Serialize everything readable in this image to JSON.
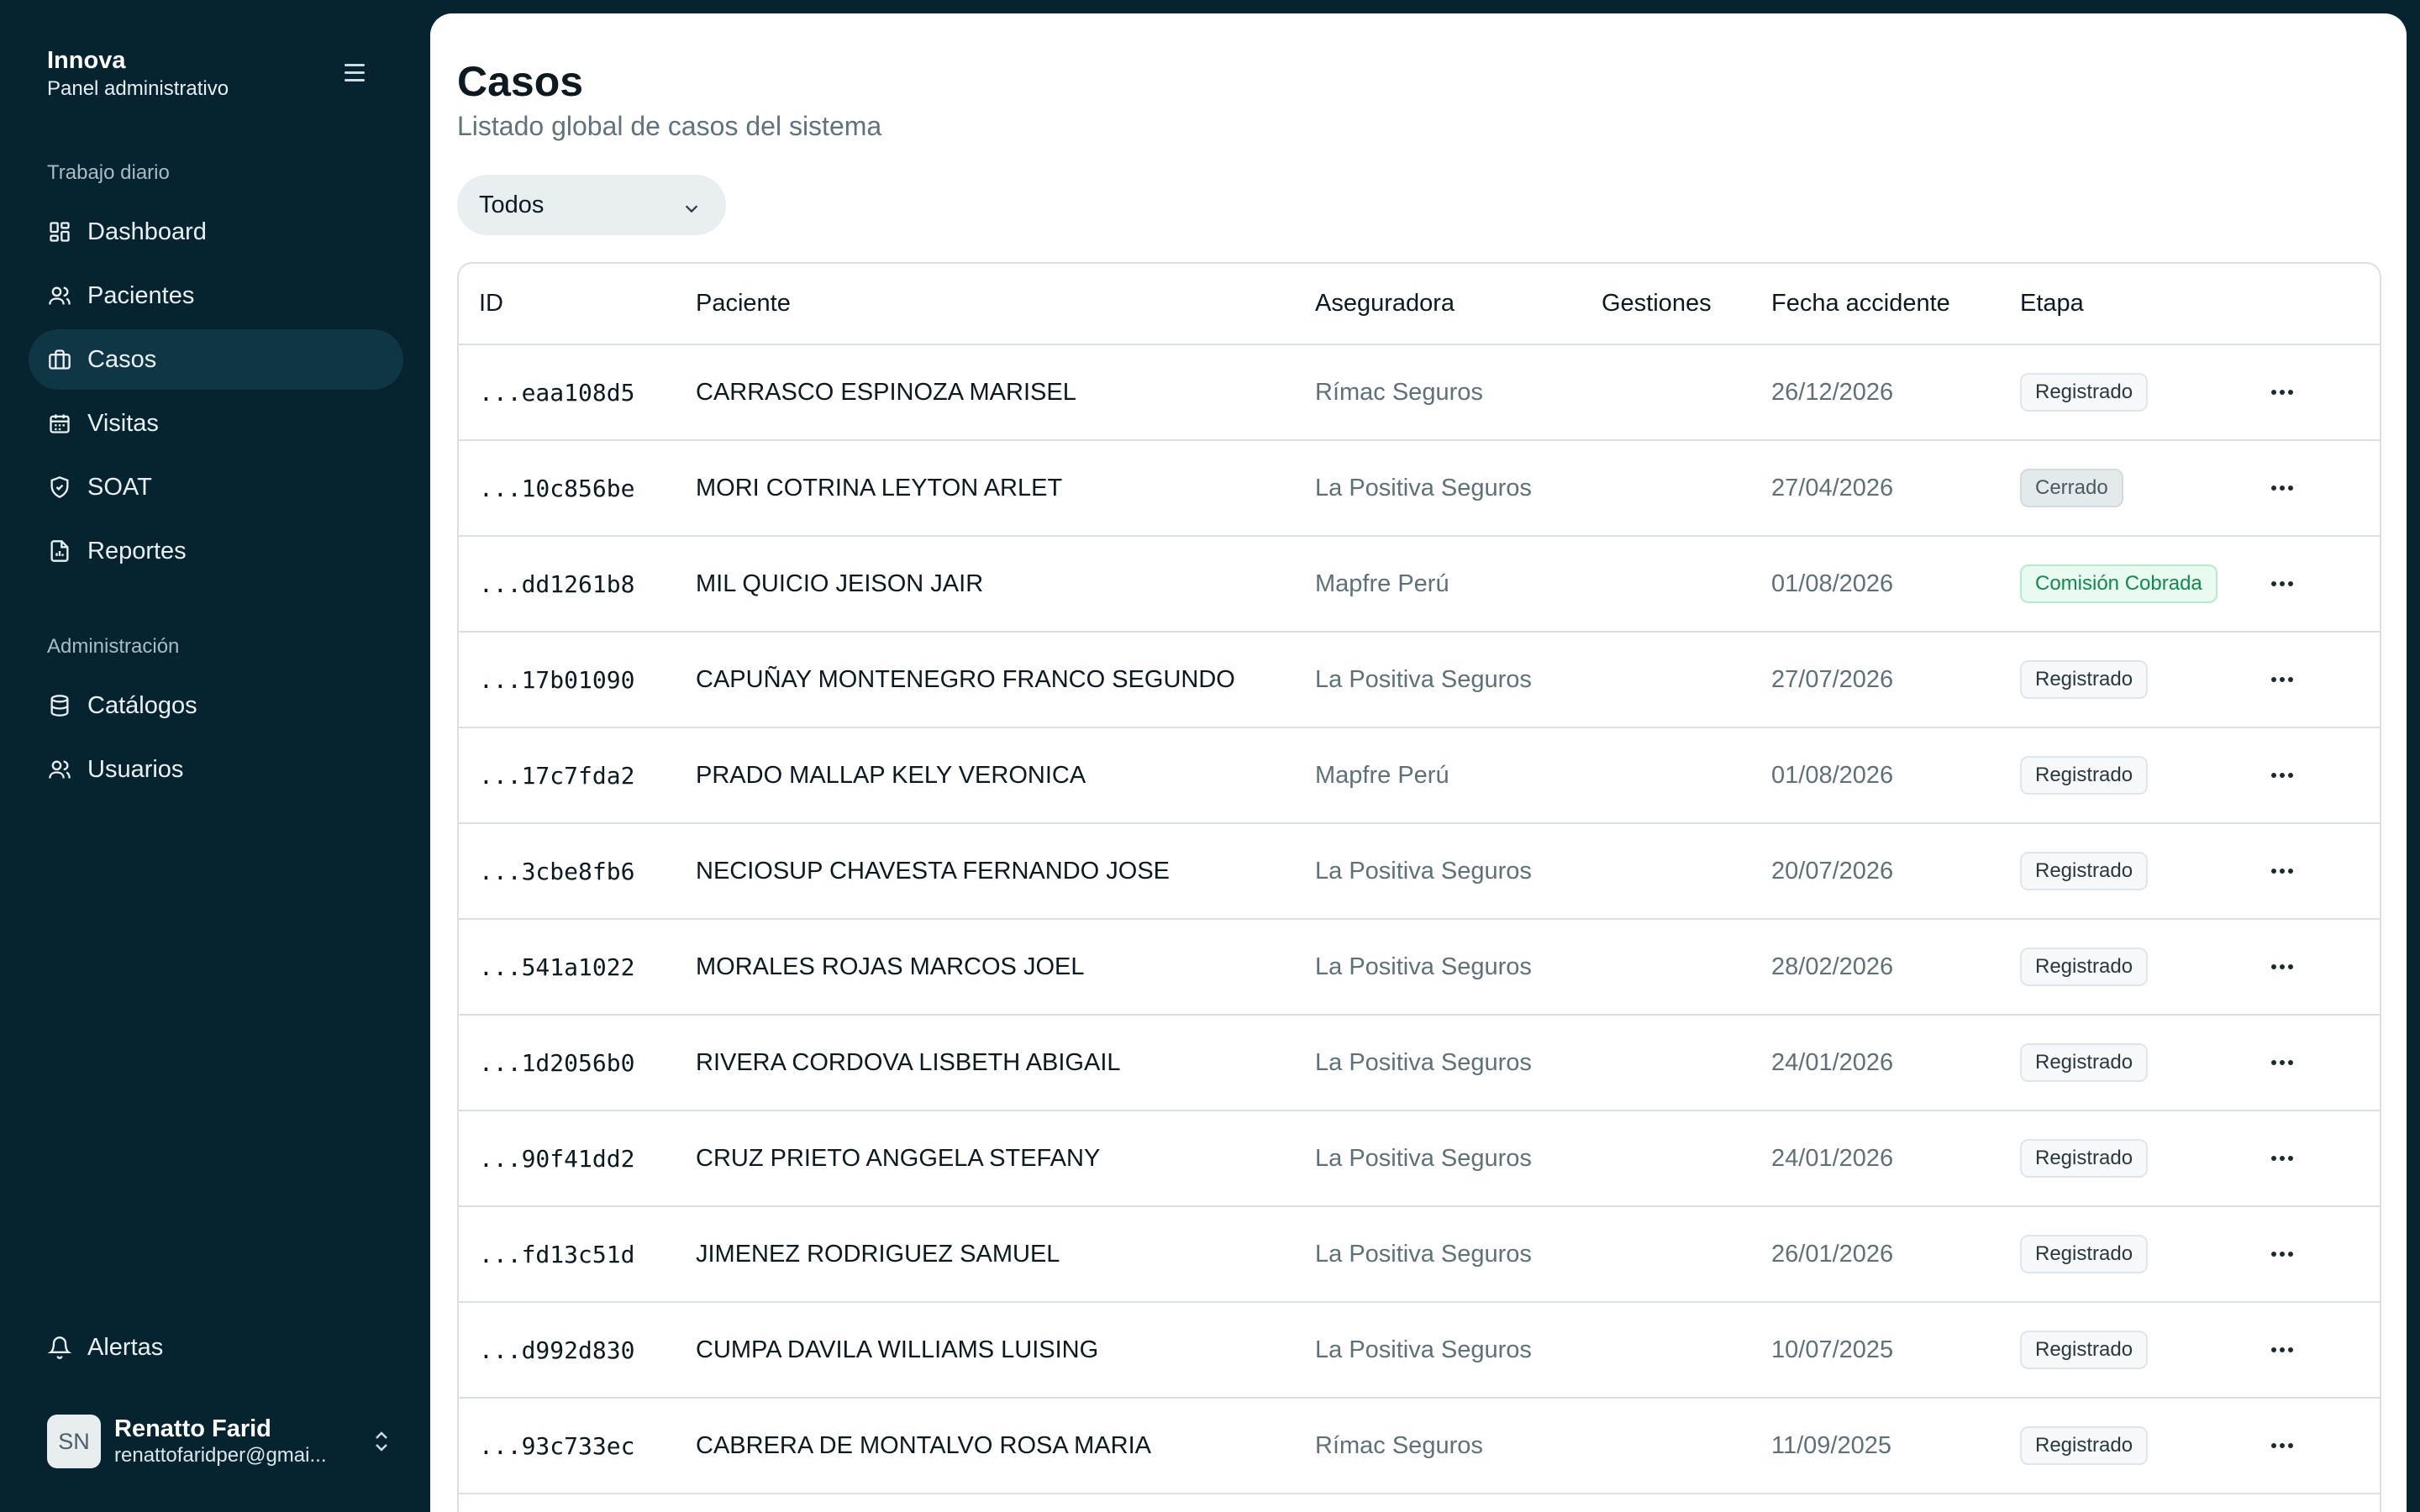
{
  "app": {
    "title": "Innova",
    "subtitle": "Panel administrativo"
  },
  "sidebar": {
    "section_daily": "Trabajo diario",
    "section_admin": "Administración",
    "items": [
      {
        "label": "Dashboard",
        "icon": "dashboard-icon"
      },
      {
        "label": "Pacientes",
        "icon": "users-icon"
      },
      {
        "label": "Casos",
        "icon": "briefcase-icon",
        "active": true
      },
      {
        "label": "Visitas",
        "icon": "calendar-icon"
      },
      {
        "label": "SOAT",
        "icon": "shield-icon"
      },
      {
        "label": "Reportes",
        "icon": "report-icon"
      }
    ],
    "admin_items": [
      {
        "label": "Catálogos",
        "icon": "database-icon"
      },
      {
        "label": "Usuarios",
        "icon": "users-icon"
      }
    ],
    "alerts_label": "Alertas",
    "user": {
      "initials": "SN",
      "name": "Renatto Farid",
      "email": "renattofaridper@gmai..."
    }
  },
  "main": {
    "title": "Casos",
    "subtitle": "Listado global de casos del sistema",
    "filter": {
      "selected": "Todos"
    },
    "table": {
      "headers": [
        "ID",
        "Paciente",
        "Aseguradora",
        "Gestiones",
        "Fecha accidente",
        "Etapa"
      ],
      "rows": [
        {
          "id": "...eaa108d5",
          "paciente": "CARRASCO ESPINOZA MARISEL",
          "aseguradora": "Rímac Seguros",
          "gestiones": "",
          "fecha": "26/12/2026",
          "etapa": "Registrado"
        },
        {
          "id": "...10c856be",
          "paciente": "MORI COTRINA LEYTON ARLET",
          "aseguradora": "La Positiva Seguros",
          "gestiones": "",
          "fecha": "27/04/2026",
          "etapa": "Cerrado"
        },
        {
          "id": "...dd1261b8",
          "paciente": "MIL QUICIO JEISON JAIR",
          "aseguradora": "Mapfre Perú",
          "gestiones": "",
          "fecha": "01/08/2026",
          "etapa": "Comisión Cobrada"
        },
        {
          "id": "...17b01090",
          "paciente": "CAPUÑAY MONTENEGRO FRANCO SEGUNDO",
          "aseguradora": "La Positiva Seguros",
          "gestiones": "",
          "fecha": "27/07/2026",
          "etapa": "Registrado"
        },
        {
          "id": "...17c7fda2",
          "paciente": "PRADO MALLAP KELY VERONICA",
          "aseguradora": "Mapfre Perú",
          "gestiones": "",
          "fecha": "01/08/2026",
          "etapa": "Registrado"
        },
        {
          "id": "...3cbe8fb6",
          "paciente": "NECIOSUP CHAVESTA FERNANDO JOSE",
          "aseguradora": "La Positiva Seguros",
          "gestiones": "",
          "fecha": "20/07/2026",
          "etapa": "Registrado"
        },
        {
          "id": "...541a1022",
          "paciente": "MORALES ROJAS MARCOS JOEL",
          "aseguradora": "La Positiva Seguros",
          "gestiones": "",
          "fecha": "28/02/2026",
          "etapa": "Registrado"
        },
        {
          "id": "...1d2056b0",
          "paciente": "RIVERA CORDOVA LISBETH ABIGAIL",
          "aseguradora": "La Positiva Seguros",
          "gestiones": "",
          "fecha": "24/01/2026",
          "etapa": "Registrado"
        },
        {
          "id": "...90f41dd2",
          "paciente": "CRUZ PRIETO ANGGELA STEFANY",
          "aseguradora": "La Positiva Seguros",
          "gestiones": "",
          "fecha": "24/01/2026",
          "etapa": "Registrado"
        },
        {
          "id": "...fd13c51d",
          "paciente": "JIMENEZ RODRIGUEZ SAMUEL",
          "aseguradora": "La Positiva Seguros",
          "gestiones": "",
          "fecha": "26/01/2026",
          "etapa": "Registrado"
        },
        {
          "id": "...d992d830",
          "paciente": "CUMPA DAVILA WILLIAMS LUISING",
          "aseguradora": "La Positiva Seguros",
          "gestiones": "",
          "fecha": "10/07/2025",
          "etapa": "Registrado"
        },
        {
          "id": "...93c733ec",
          "paciente": "CABRERA DE MONTALVO ROSA MARIA",
          "aseguradora": "Rímac Seguros",
          "gestiones": "",
          "fecha": "11/09/2025",
          "etapa": "Registrado"
        }
      ]
    }
  },
  "colors": {
    "sidebar_bg": "#062330",
    "active_item": "#0f3645",
    "success": "#0f8a4f"
  }
}
